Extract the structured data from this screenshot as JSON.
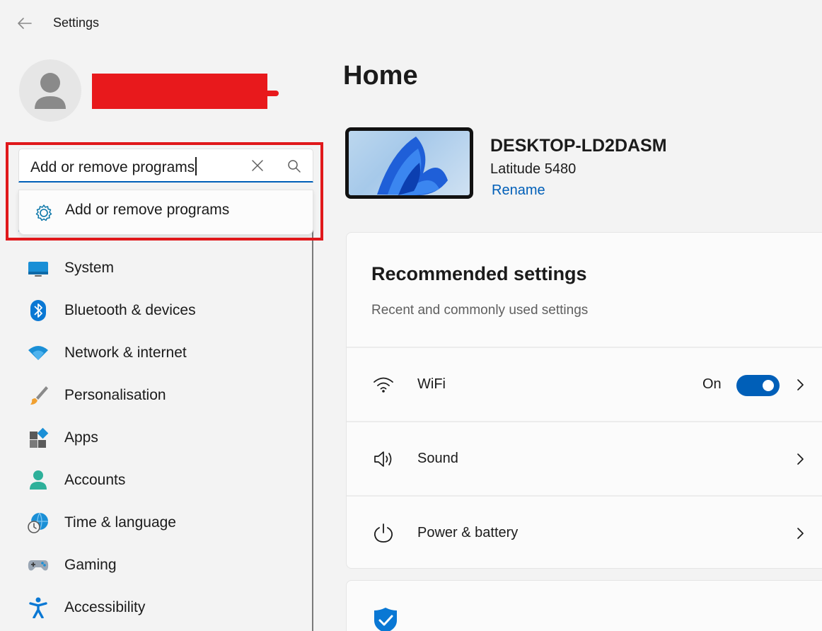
{
  "window": {
    "title": "Settings"
  },
  "search": {
    "value": "Add or remove programs",
    "suggestion": "Add or remove programs"
  },
  "sidebar": {
    "items": [
      {
        "label": "System",
        "icon": "system-icon"
      },
      {
        "label": "Bluetooth & devices",
        "icon": "bluetooth-icon"
      },
      {
        "label": "Network & internet",
        "icon": "wifi-icon"
      },
      {
        "label": "Personalisation",
        "icon": "brush-icon"
      },
      {
        "label": "Apps",
        "icon": "apps-icon"
      },
      {
        "label": "Accounts",
        "icon": "account-icon"
      },
      {
        "label": "Time & language",
        "icon": "globe-clock-icon"
      },
      {
        "label": "Gaming",
        "icon": "gamepad-icon"
      },
      {
        "label": "Accessibility",
        "icon": "accessibility-icon"
      }
    ]
  },
  "main": {
    "title": "Home",
    "device": {
      "name": "DESKTOP-LD2DASM",
      "model": "Latitude 5480",
      "rename": "Rename"
    },
    "recommended": {
      "title": "Recommended settings",
      "subtitle": "Recent and commonly used settings",
      "rows": [
        {
          "label": "WiFi",
          "state": "On",
          "icon": "wifi-icon"
        },
        {
          "label": "Sound",
          "icon": "speaker-icon"
        },
        {
          "label": "Power & battery",
          "icon": "power-icon"
        }
      ]
    }
  },
  "colors": {
    "accent": "#005fb8",
    "highlight": "#e0181b",
    "redaction": "#e8191c"
  }
}
